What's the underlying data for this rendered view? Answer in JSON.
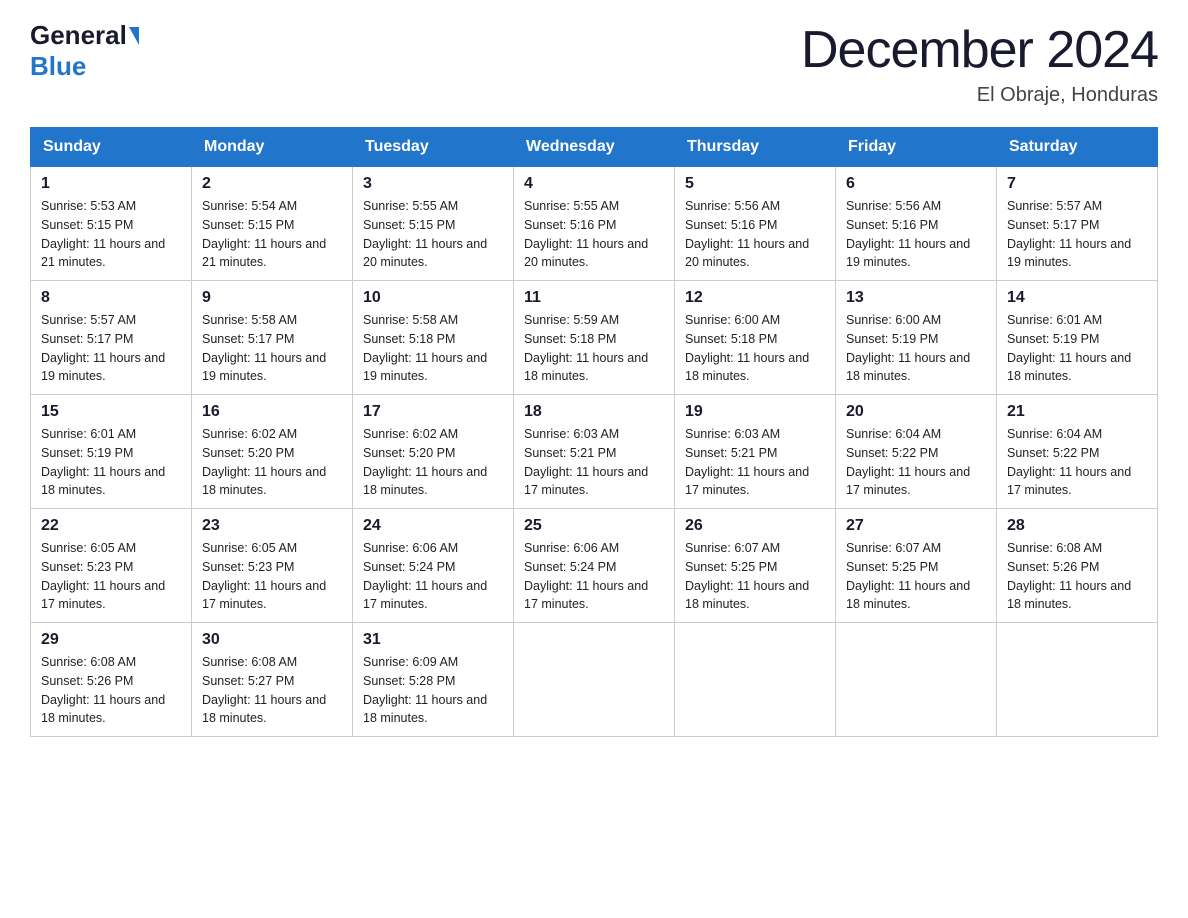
{
  "logo": {
    "general": "General",
    "blue": "Blue"
  },
  "title": {
    "month": "December 2024",
    "location": "El Obraje, Honduras"
  },
  "days_of_week": [
    "Sunday",
    "Monday",
    "Tuesday",
    "Wednesday",
    "Thursday",
    "Friday",
    "Saturday"
  ],
  "weeks": [
    [
      {
        "day": "1",
        "sunrise": "5:53 AM",
        "sunset": "5:15 PM",
        "daylight": "11 hours and 21 minutes."
      },
      {
        "day": "2",
        "sunrise": "5:54 AM",
        "sunset": "5:15 PM",
        "daylight": "11 hours and 21 minutes."
      },
      {
        "day": "3",
        "sunrise": "5:55 AM",
        "sunset": "5:15 PM",
        "daylight": "11 hours and 20 minutes."
      },
      {
        "day": "4",
        "sunrise": "5:55 AM",
        "sunset": "5:16 PM",
        "daylight": "11 hours and 20 minutes."
      },
      {
        "day": "5",
        "sunrise": "5:56 AM",
        "sunset": "5:16 PM",
        "daylight": "11 hours and 20 minutes."
      },
      {
        "day": "6",
        "sunrise": "5:56 AM",
        "sunset": "5:16 PM",
        "daylight": "11 hours and 19 minutes."
      },
      {
        "day": "7",
        "sunrise": "5:57 AM",
        "sunset": "5:17 PM",
        "daylight": "11 hours and 19 minutes."
      }
    ],
    [
      {
        "day": "8",
        "sunrise": "5:57 AM",
        "sunset": "5:17 PM",
        "daylight": "11 hours and 19 minutes."
      },
      {
        "day": "9",
        "sunrise": "5:58 AM",
        "sunset": "5:17 PM",
        "daylight": "11 hours and 19 minutes."
      },
      {
        "day": "10",
        "sunrise": "5:58 AM",
        "sunset": "5:18 PM",
        "daylight": "11 hours and 19 minutes."
      },
      {
        "day": "11",
        "sunrise": "5:59 AM",
        "sunset": "5:18 PM",
        "daylight": "11 hours and 18 minutes."
      },
      {
        "day": "12",
        "sunrise": "6:00 AM",
        "sunset": "5:18 PM",
        "daylight": "11 hours and 18 minutes."
      },
      {
        "day": "13",
        "sunrise": "6:00 AM",
        "sunset": "5:19 PM",
        "daylight": "11 hours and 18 minutes."
      },
      {
        "day": "14",
        "sunrise": "6:01 AM",
        "sunset": "5:19 PM",
        "daylight": "11 hours and 18 minutes."
      }
    ],
    [
      {
        "day": "15",
        "sunrise": "6:01 AM",
        "sunset": "5:19 PM",
        "daylight": "11 hours and 18 minutes."
      },
      {
        "day": "16",
        "sunrise": "6:02 AM",
        "sunset": "5:20 PM",
        "daylight": "11 hours and 18 minutes."
      },
      {
        "day": "17",
        "sunrise": "6:02 AM",
        "sunset": "5:20 PM",
        "daylight": "11 hours and 18 minutes."
      },
      {
        "day": "18",
        "sunrise": "6:03 AM",
        "sunset": "5:21 PM",
        "daylight": "11 hours and 17 minutes."
      },
      {
        "day": "19",
        "sunrise": "6:03 AM",
        "sunset": "5:21 PM",
        "daylight": "11 hours and 17 minutes."
      },
      {
        "day": "20",
        "sunrise": "6:04 AM",
        "sunset": "5:22 PM",
        "daylight": "11 hours and 17 minutes."
      },
      {
        "day": "21",
        "sunrise": "6:04 AM",
        "sunset": "5:22 PM",
        "daylight": "11 hours and 17 minutes."
      }
    ],
    [
      {
        "day": "22",
        "sunrise": "6:05 AM",
        "sunset": "5:23 PM",
        "daylight": "11 hours and 17 minutes."
      },
      {
        "day": "23",
        "sunrise": "6:05 AM",
        "sunset": "5:23 PM",
        "daylight": "11 hours and 17 minutes."
      },
      {
        "day": "24",
        "sunrise": "6:06 AM",
        "sunset": "5:24 PM",
        "daylight": "11 hours and 17 minutes."
      },
      {
        "day": "25",
        "sunrise": "6:06 AM",
        "sunset": "5:24 PM",
        "daylight": "11 hours and 17 minutes."
      },
      {
        "day": "26",
        "sunrise": "6:07 AM",
        "sunset": "5:25 PM",
        "daylight": "11 hours and 18 minutes."
      },
      {
        "day": "27",
        "sunrise": "6:07 AM",
        "sunset": "5:25 PM",
        "daylight": "11 hours and 18 minutes."
      },
      {
        "day": "28",
        "sunrise": "6:08 AM",
        "sunset": "5:26 PM",
        "daylight": "11 hours and 18 minutes."
      }
    ],
    [
      {
        "day": "29",
        "sunrise": "6:08 AM",
        "sunset": "5:26 PM",
        "daylight": "11 hours and 18 minutes."
      },
      {
        "day": "30",
        "sunrise": "6:08 AM",
        "sunset": "5:27 PM",
        "daylight": "11 hours and 18 minutes."
      },
      {
        "day": "31",
        "sunrise": "6:09 AM",
        "sunset": "5:28 PM",
        "daylight": "11 hours and 18 minutes."
      },
      null,
      null,
      null,
      null
    ]
  ]
}
